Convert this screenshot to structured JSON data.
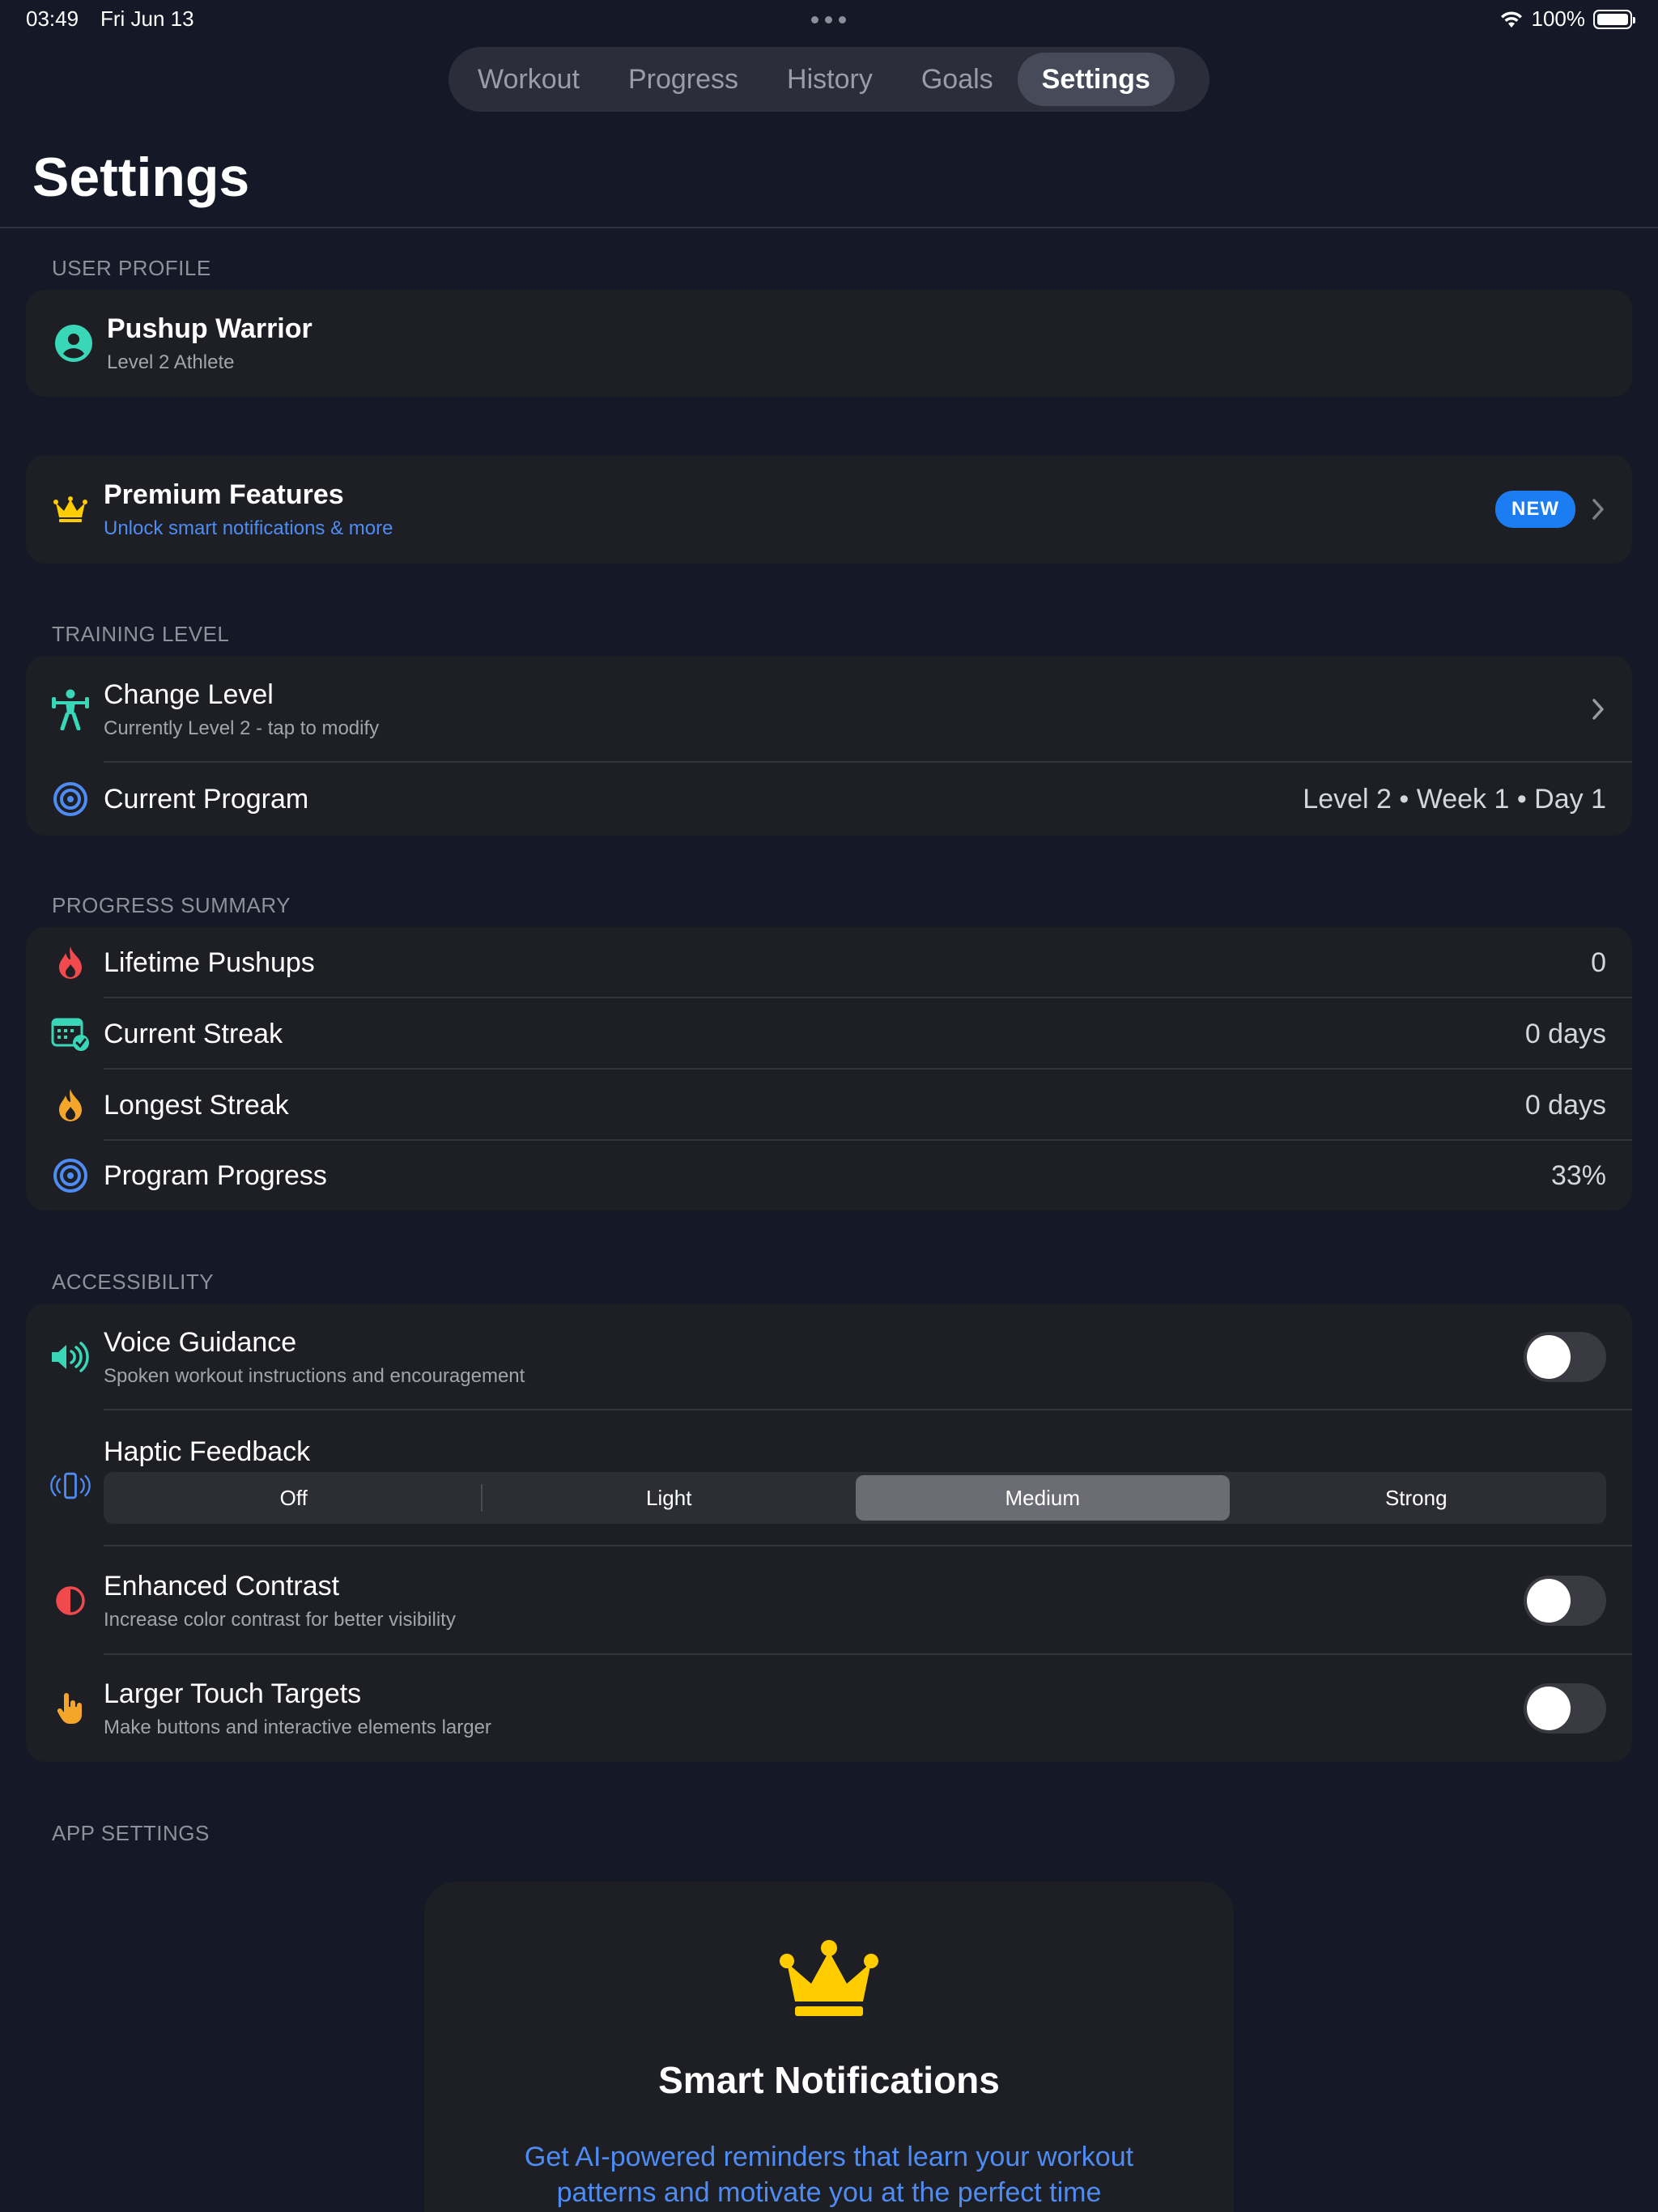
{
  "status_bar": {
    "time": "03:49",
    "date": "Fri Jun 13",
    "battery": "100%"
  },
  "nav": {
    "tabs": [
      {
        "label": "Workout"
      },
      {
        "label": "Progress"
      },
      {
        "label": "History"
      },
      {
        "label": "Goals"
      },
      {
        "label": "Settings",
        "active": true
      }
    ]
  },
  "page_title": "Settings",
  "user_profile": {
    "header": "USER PROFILE",
    "name": "Pushup Warrior",
    "subtitle": "Level 2 Athlete",
    "icon": "person-circle-icon"
  },
  "premium": {
    "title": "Premium Features",
    "subtitle": "Unlock smart notifications & more",
    "badge": "NEW",
    "icon": "crown-icon"
  },
  "training_level": {
    "header": "TRAINING LEVEL",
    "change_level": {
      "title": "Change Level",
      "subtitle": "Currently Level 2 - tap to modify"
    },
    "current_program": {
      "title": "Current Program",
      "value": "Level 2 • Week 1 • Day 1"
    }
  },
  "progress_summary": {
    "header": "PROGRESS SUMMARY",
    "items": [
      {
        "label": "Lifetime Pushups",
        "value": "0",
        "icon": "flame-icon"
      },
      {
        "label": "Current Streak",
        "value": "0 days",
        "icon": "calendar-check-icon"
      },
      {
        "label": "Longest Streak",
        "value": "0 days",
        "icon": "flame-orange-icon"
      },
      {
        "label": "Program Progress",
        "value": "33%",
        "icon": "target-icon"
      }
    ]
  },
  "accessibility": {
    "header": "ACCESSIBILITY",
    "voice_guidance": {
      "title": "Voice Guidance",
      "subtitle": "Spoken workout instructions and encouragement",
      "on": false
    },
    "haptic": {
      "title": "Haptic Feedback",
      "options": [
        "Off",
        "Light",
        "Medium",
        "Strong"
      ],
      "selected": "Medium"
    },
    "contrast": {
      "title": "Enhanced Contrast",
      "subtitle": "Increase color contrast for better visibility",
      "on": false
    },
    "touch_targets": {
      "title": "Larger Touch Targets",
      "subtitle": "Make buttons and interactive elements larger",
      "on": false
    }
  },
  "app_settings": {
    "header": "APP SETTINGS",
    "promo": {
      "title": "Smart Notifications",
      "text": "Get AI-powered reminders that learn your workout patterns and motivate you at the perfect time"
    }
  },
  "colors": {
    "background": "#151826",
    "card": "#1e1f24",
    "accent_blue": "#4e8cf3",
    "accent_teal": "#3ad6b8",
    "crown_yellow": "#ffcc00",
    "badge_blue": "#1c7cf2"
  }
}
